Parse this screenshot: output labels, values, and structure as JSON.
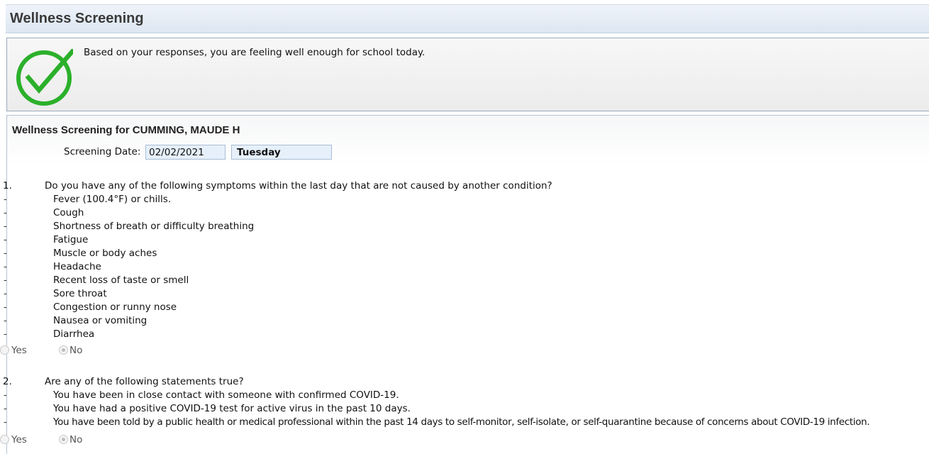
{
  "header": {
    "title": "Wellness Screening"
  },
  "result": {
    "icon": "check-circle-icon",
    "icon_color": "#2bb02b",
    "message": "Based on your responses, you are feeling well enough for school today."
  },
  "form": {
    "title": "Wellness Screening for CUMMING, MAUDE H",
    "date_label": "Screening Date:",
    "date_value": "02/02/2021",
    "day_value": "Tuesday"
  },
  "questions": [
    {
      "number": "1.",
      "text": "Do you have any of the following symptoms within the last day that are not caused by another condition?",
      "items": [
        "Fever (100.4°F) or chills.",
        "Cough",
        "Shortness of breath or difficulty breathing",
        "Fatigue",
        "Muscle or body aches",
        "Headache",
        "Recent loss of taste or smell",
        "Sore throat",
        "Congestion or runny nose",
        "Nausea or vomiting",
        "Diarrhea"
      ],
      "options": [
        "Yes",
        "No"
      ],
      "selected": "No"
    },
    {
      "number": "2.",
      "text": "Are any of the following statements true?",
      "items": [
        "You have been in close contact with someone with confirmed COVID-19.",
        "You have had a positive COVID-19 test for active virus in the past 10 days.",
        "You have been told by a public health or medical professional within the past 14 days to self-monitor, self-isolate, or self-quarantine because of concerns about COVID-19 infection."
      ],
      "options": [
        "Yes",
        "No"
      ],
      "selected": "No"
    }
  ],
  "bullet_marker": "-"
}
